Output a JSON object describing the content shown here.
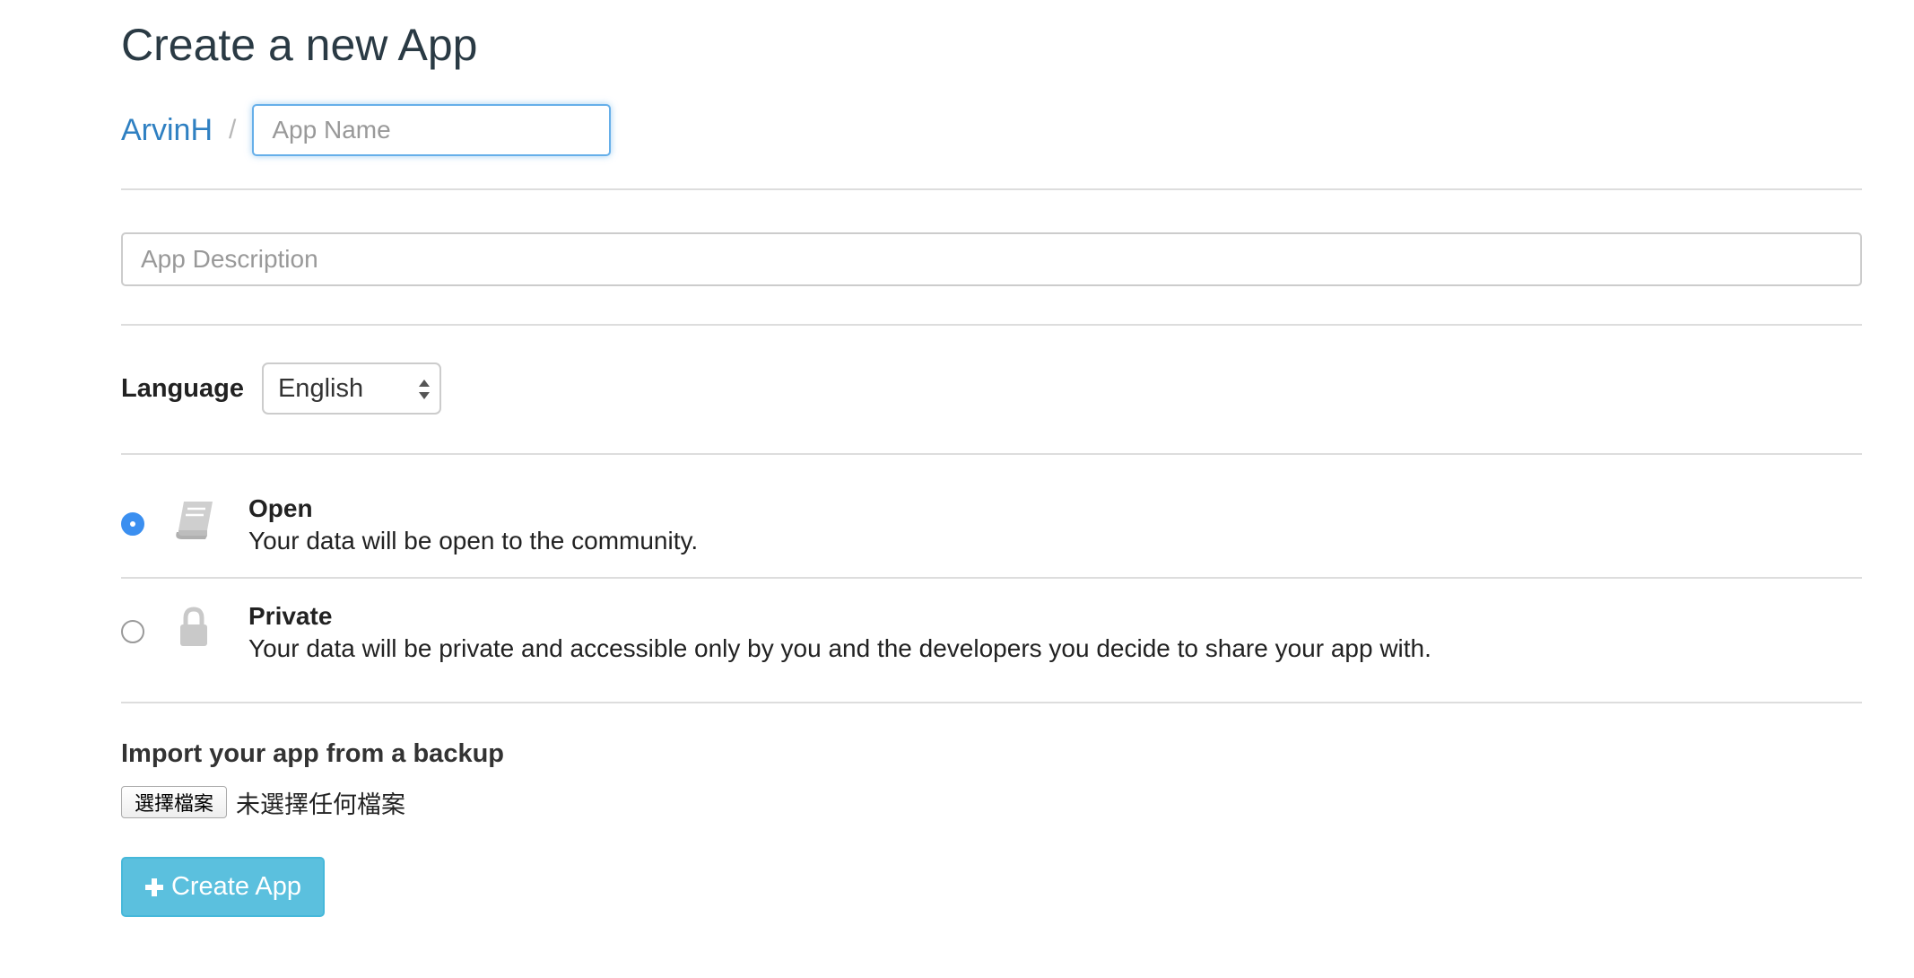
{
  "page": {
    "title": "Create a new App"
  },
  "owner": {
    "name": "ArvinH",
    "separator": "/"
  },
  "fields": {
    "app_name": {
      "value": "",
      "placeholder": "App Name"
    },
    "app_description": {
      "value": "",
      "placeholder": "App Description"
    }
  },
  "language": {
    "label": "Language",
    "selected": "English"
  },
  "visibility": {
    "options": [
      {
        "id": "open",
        "title": "Open",
        "description": "Your data will be open to the community.",
        "icon": "book-icon",
        "selected": true
      },
      {
        "id": "private",
        "title": "Private",
        "description": "Your data will be private and accessible only by you and the developers you decide to share your app with.",
        "icon": "lock-icon",
        "selected": false
      }
    ]
  },
  "import": {
    "label": "Import your app from a backup",
    "choose_file_label": "選擇檔案",
    "no_file_text": "未選擇任何檔案"
  },
  "submit": {
    "label": "Create App",
    "icon": "plus-icon"
  },
  "colors": {
    "link": "#2f80c2",
    "radio_selected": "#3b8ff0",
    "button_info": "#5bc0de",
    "focus_border": "#66afe9"
  }
}
